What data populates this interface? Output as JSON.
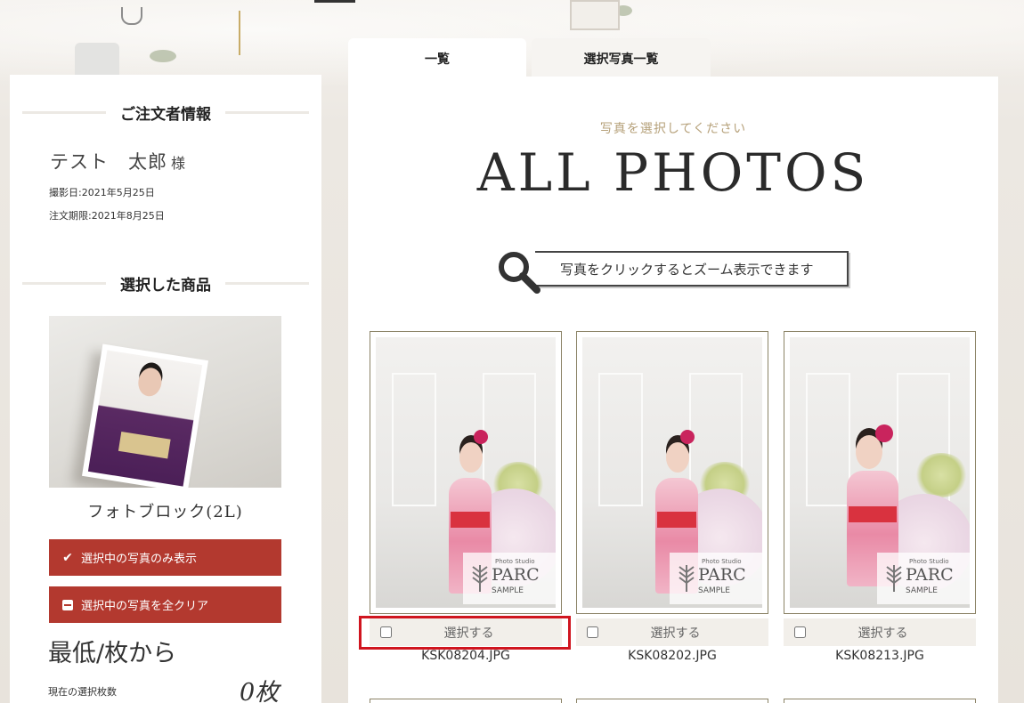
{
  "tabs": [
    {
      "label": "一覧",
      "active": true
    },
    {
      "label": "選択写真一覧",
      "active": false
    }
  ],
  "sidebar": {
    "orderer_heading": "ご注文者情報",
    "customer_name": "テスト　太郎",
    "customer_honorific": "様",
    "shoot_date": "撮影日:2021年5月25日",
    "order_deadline": "注文期限:2021年8月25日",
    "product_heading": "選択した商品",
    "product_name": "フォトブロック(2L)",
    "show_selected_button": "選択中の写真のみ表示",
    "clear_selected_button": "選択中の写真を全クリア",
    "minimum_text": "最低/枚から",
    "current_count_label": "現在の選択枚数",
    "current_count_value": "0枚"
  },
  "main": {
    "subheading": "写真を選択してください",
    "title": "ALL PHOTOS",
    "zoom_hint": "写真をクリックするとズーム表示できます",
    "select_label": "選択する",
    "watermark": {
      "studio": "Photo Studio",
      "brand": "PARC",
      "sample": "SAMPLE"
    },
    "photos": [
      {
        "filename": "KSK08204.JPG",
        "selected": false
      },
      {
        "filename": "KSK08202.JPG",
        "selected": false
      },
      {
        "filename": "KSK08213.JPG",
        "selected": false
      }
    ]
  },
  "colors": {
    "accent_red": "#b3392f",
    "gold_text": "#b6a17a",
    "highlight_red": "#d0151f"
  }
}
